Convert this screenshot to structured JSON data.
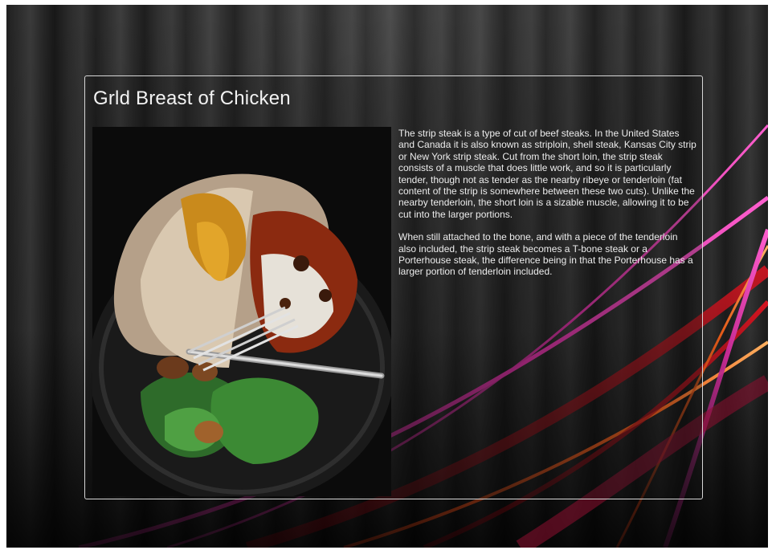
{
  "slide": {
    "title": "Grld Breast of Chicken",
    "paragraphs": [
      "The strip steak is a type of cut of beef steaks. In the United States and Canada  it is also known as striploin, shell steak, Kansas City strip or New York strip steak. Cut from the short loin, the strip steak consists of a muscle that does little work, and so it is particularly tender, though not as tender as the nearby ribeye or tenderloin  (fat content of the strip is somewhere between these two cuts). Unlike the nearby tenderloin, the short loin is a sizable muscle, allowing it to be cut into the larger portions.",
      "When still attached to the bone, and with a piece of the tenderloin also included, the strip steak becomes a T-bone steak or a Porterhouse steak, the difference being in that the Porterhouse has a larger portion of tenderloin included."
    ]
  },
  "colors": {
    "accent_magenta": "#b8248c",
    "accent_orange": "#e0591a",
    "accent_red": "#c0121a",
    "panel_border": "#d7d7d7"
  }
}
